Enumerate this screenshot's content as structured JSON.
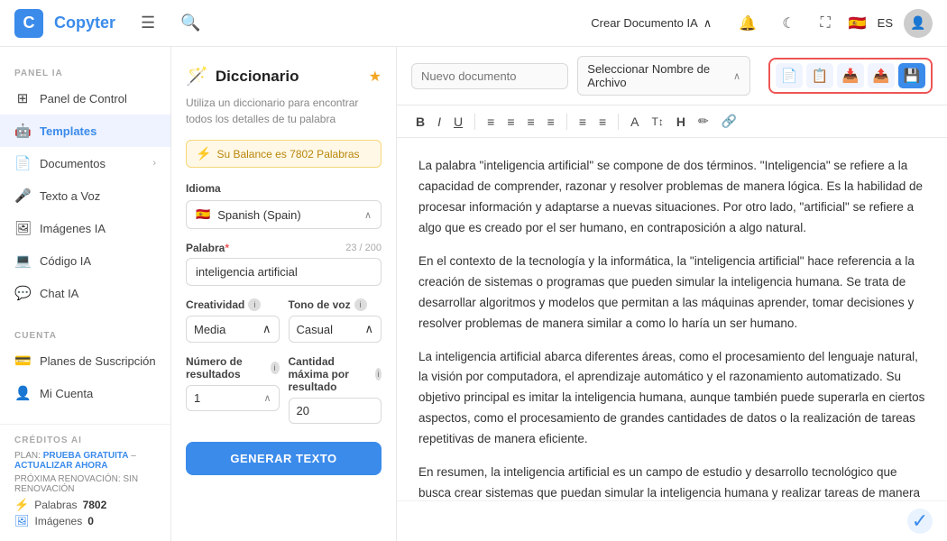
{
  "app": {
    "logo_letter": "C",
    "logo_text": "Copyter"
  },
  "topnav": {
    "menu_icon": "☰",
    "search_icon": "🔍",
    "create_label": "Crear Documento IA",
    "create_chevron": "∧",
    "bell_icon": "🔔",
    "moon_icon": "☾",
    "expand_icon": "⛶",
    "flag_emoji": "🇪🇸",
    "lang_label": "ES"
  },
  "sidebar": {
    "panel_section": "PANEL IA",
    "items": [
      {
        "id": "panel-de-control",
        "icon": "⊞",
        "label": "Panel de Control",
        "arrow": ""
      },
      {
        "id": "templates",
        "icon": "🤖",
        "label": "Templates",
        "arrow": ""
      },
      {
        "id": "documentos",
        "icon": "📄",
        "label": "Documentos",
        "arrow": "›"
      },
      {
        "id": "texto-a-voz",
        "icon": "🎤",
        "label": "Texto a Voz",
        "arrow": ""
      },
      {
        "id": "imagenes-ia",
        "icon": "🖼",
        "label": "Imágenes IA",
        "arrow": ""
      },
      {
        "id": "codigo-ia",
        "icon": "💻",
        "label": "Código IA",
        "arrow": ""
      },
      {
        "id": "chat-ia",
        "icon": "💬",
        "label": "Chat IA",
        "arrow": ""
      }
    ],
    "cuenta_section": "CUENTA",
    "cuenta_items": [
      {
        "id": "planes",
        "icon": "💳",
        "label": "Planes de Suscripción",
        "arrow": ""
      },
      {
        "id": "mi-cuenta",
        "icon": "👤",
        "label": "Mi Cuenta",
        "arrow": ""
      }
    ],
    "credits_section": "CRÉDITOS AI",
    "plan_label": "PLAN:",
    "plan_name": "PRUEBA GRATUITA",
    "plan_sep": "–",
    "upgrade_label": "ACTUALIZAR AHORA",
    "renovacion_label": "PRÓXIMA RENOVACIÓN: SIN RENOVACIÓN",
    "palabras_label": "Palabras",
    "palabras_value": "7802",
    "imagenes_label": "Imágenes",
    "imagenes_value": "0"
  },
  "dict_panel": {
    "icon": "🪄",
    "title": "Diccionario",
    "star_icon": "★",
    "description": "Utiliza un diccionario para encontrar todos los detalles de tu palabra",
    "balance_icon": "⚡",
    "balance_text": "Su Balance es 7802 Palabras",
    "idioma_label": "Idioma",
    "flag": "🇪🇸",
    "lang_value": "Spanish (Spain)",
    "lang_chevron": "∧",
    "palabra_label": "Palabra",
    "palabra_required": "*",
    "word_count": "23 / 200",
    "word_value": "inteligencia artificial",
    "creatividad_label": "Creatividad",
    "creatividad_value": "Media",
    "tono_label": "Tono de voz",
    "tono_value": "Casual",
    "num_resultados_label": "Número de resultados",
    "num_resultados_value": "1",
    "max_resultado_label": "Cantidad máxima por resultado",
    "max_resultado_value": "20",
    "generate_btn": "GENERAR TEXTO"
  },
  "editor": {
    "doc_name_placeholder": "Nuevo documento",
    "file_selector_label": "Seleccionar Nombre de Archivo",
    "file_chevron": "∧",
    "action_icons": [
      {
        "id": "copy-doc",
        "icon": "📄",
        "active": false
      },
      {
        "id": "copy-text",
        "icon": "📋",
        "active": false
      },
      {
        "id": "download-doc",
        "icon": "📥",
        "active": false
      },
      {
        "id": "share",
        "icon": "📤",
        "active": false
      },
      {
        "id": "save",
        "icon": "💾",
        "active": true
      }
    ],
    "format_buttons": [
      {
        "id": "bold",
        "label": "B",
        "style": "bold"
      },
      {
        "id": "italic",
        "label": "I",
        "style": "italic"
      },
      {
        "id": "underline",
        "label": "U",
        "style": "underline"
      },
      {
        "id": "align-left",
        "label": "≡"
      },
      {
        "id": "align-center",
        "label": "≡"
      },
      {
        "id": "align-right",
        "label": "≡"
      },
      {
        "id": "align-justify",
        "label": "≡"
      },
      {
        "id": "ordered-list",
        "label": "≡"
      },
      {
        "id": "unordered-list",
        "label": "≡"
      },
      {
        "id": "indent",
        "label": "A"
      },
      {
        "id": "heading",
        "label": "T↕"
      },
      {
        "id": "font-h",
        "label": "H"
      },
      {
        "id": "brush",
        "label": "✏"
      },
      {
        "id": "link",
        "label": "🔗"
      }
    ],
    "paragraphs": [
      "La palabra \"inteligencia artificial\" se compone de dos términos. \"Inteligencia\" se refiere a la capacidad de comprender, razonar y resolver problemas de manera lógica. Es la habilidad de procesar información y adaptarse a nuevas situaciones. Por otro lado, \"artificial\" se refiere a algo que es creado por el ser humano, en contraposición a algo natural.",
      "En el contexto de la tecnología y la informática, la \"inteligencia artificial\" hace referencia a la creación de sistemas o programas que pueden simular la inteligencia humana. Se trata de desarrollar algoritmos y modelos que permitan a las máquinas aprender, tomar decisiones y resolver problemas de manera similar a como lo haría un ser humano.",
      "La inteligencia artificial abarca diferentes áreas, como el procesamiento del lenguaje natural, la visión por computadora, el aprendizaje automático y el razonamiento automatizado. Su objetivo principal es imitar la inteligencia humana, aunque también puede superarla en ciertos aspectos, como el procesamiento de grandes cantidades de datos o la realización de tareas repetitivas de manera eficiente.",
      "En resumen, la inteligencia artificial es un campo de estudio y desarrollo tecnológico que busca crear sistemas que puedan simular la inteligencia humana y realizar tareas de manera autónoma."
    ],
    "check_icon": "✓"
  }
}
